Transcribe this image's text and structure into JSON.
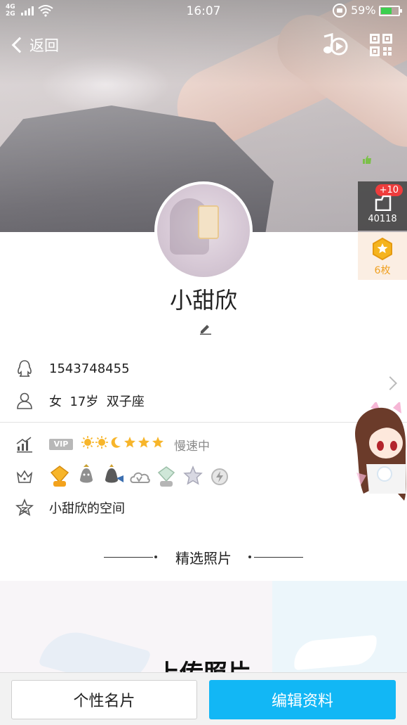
{
  "status_bar": {
    "network": "4G\n2G",
    "time": "16:07",
    "battery_percent": "59%"
  },
  "nav": {
    "back_label": "返回"
  },
  "side": {
    "like_badge": "+10",
    "like_count": "40118",
    "coin_label": "6枚"
  },
  "profile": {
    "nickname": "小甜欣",
    "qq_number": "1543748455",
    "basic_info": "女  17岁  双子座",
    "vip_label": "VIP",
    "speed_label": "慢速中",
    "space_label": "小甜欣的空间"
  },
  "levels": [
    "sun",
    "sun",
    "moon",
    "star",
    "star",
    "star"
  ],
  "badges": [
    "diamond-lv5-icon",
    "penguin-icon",
    "penguin-fish-icon",
    "cloud-v-icon",
    "gem-lv1-icon",
    "star-badge-icon",
    "lightning-badge-icon"
  ],
  "featured": {
    "title": "精选照片",
    "upload_label": "上传照片"
  },
  "buttons": {
    "card_label": "个性名片",
    "edit_label": "编辑资料"
  },
  "colors": {
    "accent": "#12b7f5",
    "badge_red": "#ee3c3c",
    "coin_orange": "#f0a020"
  }
}
